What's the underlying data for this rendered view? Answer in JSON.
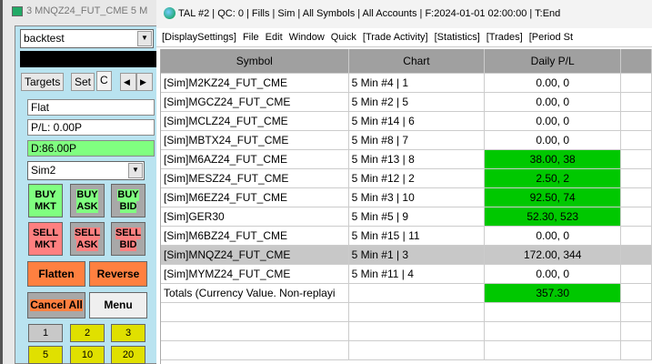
{
  "left_window": {
    "title": "3 MNQZ24_FUT_CME  5 M",
    "account_combo": "backtest",
    "tabs": [
      "Targets",
      "Set",
      "C"
    ],
    "status": "Flat",
    "pl": "P/L: 0.00P",
    "daily": "D:86.00P",
    "trade_account": "Sim2",
    "buttons": {
      "buy_mkt": [
        "BUY",
        "MKT"
      ],
      "buy_ask": [
        "BUY",
        "ASK"
      ],
      "buy_bid": [
        "BUY",
        "BID"
      ],
      "sell_mkt": [
        "SELL",
        "MKT"
      ],
      "sell_ask": [
        "SELL",
        "ASK"
      ],
      "sell_bid": [
        "SELL",
        "BID"
      ],
      "flatten": "Flatten",
      "reverse": "Reverse",
      "cancel_all": "Cancel All",
      "menu": "Menu"
    },
    "qty": [
      "1",
      "2",
      "3",
      "5",
      "10",
      "20"
    ]
  },
  "right_window": {
    "title": "TAL #2 | QC: 0 | Fills | Sim | All Symbols | All Accounts | F:2024-01-01  02:00:00 | T:End",
    "menu": [
      "[DisplaySettings]",
      "File",
      "Edit",
      "Window",
      "Quick",
      "[Trade Activity]",
      "[Statistics]",
      "[Trades]",
      "[Period St"
    ],
    "columns": [
      "Symbol",
      "Chart",
      "Daily P/L"
    ],
    "rows": [
      {
        "symbol": "[Sim]M2KZ24_FUT_CME",
        "chart": "5 Min  #4 | 1",
        "pl": "0.00, 0",
        "green": false
      },
      {
        "symbol": "[Sim]MGCZ24_FUT_CME",
        "chart": "5 Min  #2 | 5",
        "pl": "0.00, 0",
        "green": false
      },
      {
        "symbol": "[Sim]MCLZ24_FUT_CME",
        "chart": "5 Min  #14 | 6",
        "pl": "0.00, 0",
        "green": false
      },
      {
        "symbol": "[Sim]MBTX24_FUT_CME",
        "chart": "5 Min  #8 | 7",
        "pl": "0.00, 0",
        "green": false
      },
      {
        "symbol": "[Sim]M6AZ24_FUT_CME",
        "chart": "5 Min  #13 | 8",
        "pl": "38.00, 38",
        "green": true
      },
      {
        "symbol": "[Sim]MESZ24_FUT_CME",
        "chart": "5 Min  #12 | 2",
        "pl": "2.50, 2",
        "green": true
      },
      {
        "symbol": "[Sim]M6EZ24_FUT_CME",
        "chart": "5 Min  #3 | 10",
        "pl": "92.50, 74",
        "green": true
      },
      {
        "symbol": "[Sim]GER30",
        "chart": "5 Min  #5 | 9",
        "pl": "52.30, 523",
        "green": true
      },
      {
        "symbol": "[Sim]M6BZ24_FUT_CME",
        "chart": "5 Min  #15 | 11",
        "pl": "0.00, 0",
        "green": false
      },
      {
        "symbol": "[Sim]MNQZ24_FUT_CME",
        "chart": "5 Min  #1 | 3",
        "pl": "172.00, 344",
        "green": false,
        "selected": true
      },
      {
        "symbol": "[Sim]MYMZ24_FUT_CME",
        "chart": "5 Min  #11 | 4",
        "pl": "0.00, 0",
        "green": false
      }
    ],
    "totals": {
      "label": "Totals (Currency Value. Non-replayi",
      "pl": "357.30"
    }
  }
}
